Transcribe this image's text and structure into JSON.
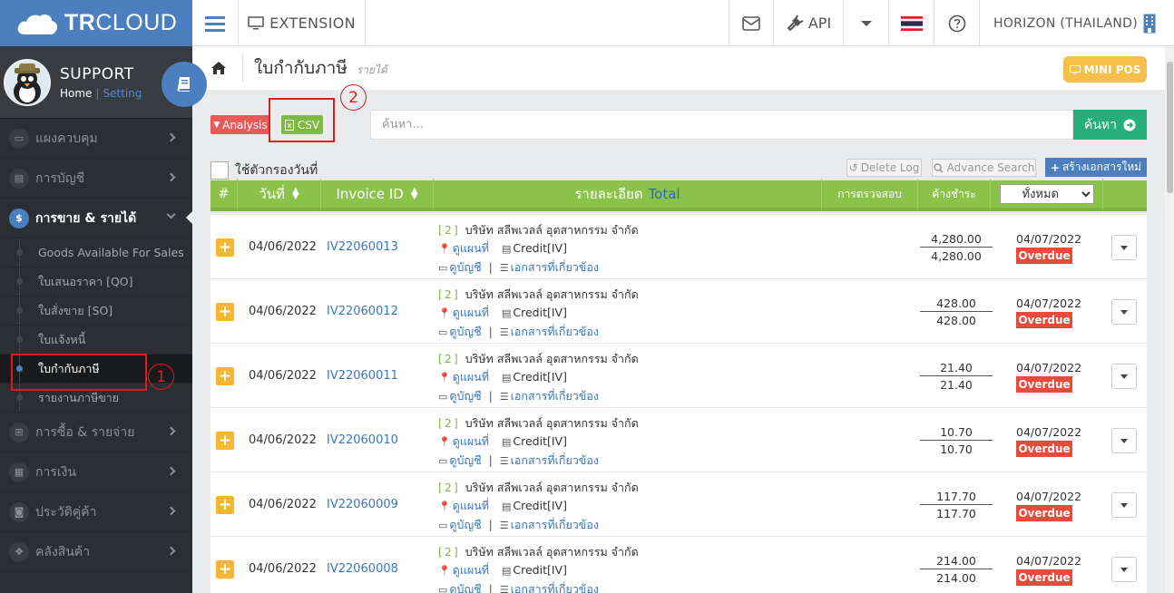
{
  "brand": {
    "text_bold": "TR",
    "text_light": "CLOUD"
  },
  "profile": {
    "name": "SUPPORT",
    "home": "Home",
    "setting": "Setting"
  },
  "sidebar": {
    "items_top": [
      {
        "label": "แผงควบคุม"
      },
      {
        "label": "การบัญชี"
      },
      {
        "label": "การขาย & รายได้"
      }
    ],
    "sub_items": [
      {
        "label": "Goods Available For Sales"
      },
      {
        "label": "ใบเสนอราคา [QO]"
      },
      {
        "label": "ใบสั่งขาย [SO]"
      },
      {
        "label": "ใบแจ้งหนี้"
      },
      {
        "label": "ใบกำกับภาษี"
      },
      {
        "label": "รายงานภาษีขาย"
      }
    ],
    "items_bottom": [
      {
        "label": "การซื้อ & รายจ่าย"
      },
      {
        "label": "การเงิน"
      },
      {
        "label": "ประวัติคู่ค้า"
      },
      {
        "label": "คลังสินค้า"
      }
    ]
  },
  "topbar": {
    "extension": "EXTENSION",
    "api": "API",
    "company": "HORIZON (THAILAND)"
  },
  "page": {
    "title": "ใบกำกับภาษี",
    "subtitle": "รายได้",
    "mini_pos": "MINI POS"
  },
  "toolbar": {
    "analysis": "Analysis",
    "csv": "CSV",
    "search_placeholder": "ค้นหา...",
    "search_btn": "ค้นหา",
    "date_filter": "ใช้ตัวกรองวันที่",
    "delete_log": "Delete Log",
    "advance_search": "Advance Search",
    "create_doc": "สร้างเอกสารใหม่"
  },
  "annotations": {
    "one": "1",
    "two": "2"
  },
  "table": {
    "headers": {
      "num": "#",
      "date": "วันที่",
      "invoice": "Invoice ID",
      "detail": "รายละเอียด",
      "total": "Total",
      "check": "การตรวจสอบ",
      "outstanding": "ค้างชำระ",
      "status_selected": "ทั้งหมด"
    },
    "rows": [
      {
        "date": "04/06/2022",
        "invoice": "IV22060013",
        "count": "[2]",
        "company": "บริษัท สลีพเวลล์ อุตสาหกรรม จำกัด",
        "map": "ดูแผนที่",
        "credit": "Credit[IV]",
        "account": "ดูบัญชี",
        "docs": "เอกสารที่เกี่ยวข้อง",
        "amount1": "4,280.00",
        "amount2": "4,280.00",
        "due": "04/07/2022",
        "status": "Overdue"
      },
      {
        "date": "04/06/2022",
        "invoice": "IV22060012",
        "count": "[2]",
        "company": "บริษัท สลีพเวลล์ อุตสาหกรรม จำกัด",
        "map": "ดูแผนที่",
        "credit": "Credit[IV]",
        "account": "ดูบัญชี",
        "docs": "เอกสารที่เกี่ยวข้อง",
        "amount1": "428.00",
        "amount2": "428.00",
        "due": "04/07/2022",
        "status": "Overdue"
      },
      {
        "date": "04/06/2022",
        "invoice": "IV22060011",
        "count": "[2]",
        "company": "บริษัท สลีพเวลล์ อุตสาหกรรม จำกัด",
        "map": "ดูแผนที่",
        "credit": "Credit[IV]",
        "account": "ดูบัญชี",
        "docs": "เอกสารที่เกี่ยวข้อง",
        "amount1": "21.40",
        "amount2": "21.40",
        "due": "04/07/2022",
        "status": "Overdue"
      },
      {
        "date": "04/06/2022",
        "invoice": "IV22060010",
        "count": "[2]",
        "company": "บริษัท สลีพเวลล์ อุตสาหกรรม จำกัด",
        "map": "ดูแผนที่",
        "credit": "Credit[IV]",
        "account": "ดูบัญชี",
        "docs": "เอกสารที่เกี่ยวข้อง",
        "amount1": "10.70",
        "amount2": "10.70",
        "due": "04/07/2022",
        "status": "Overdue"
      },
      {
        "date": "04/06/2022",
        "invoice": "IV22060009",
        "count": "[2]",
        "company": "บริษัท สลีพเวลล์ อุตสาหกรรม จำกัด",
        "map": "ดูแผนที่",
        "credit": "Credit[IV]",
        "account": "ดูบัญชี",
        "docs": "เอกสารที่เกี่ยวข้อง",
        "amount1": "117.70",
        "amount2": "117.70",
        "due": "04/07/2022",
        "status": "Overdue"
      },
      {
        "date": "04/06/2022",
        "invoice": "IV22060008",
        "count": "[2]",
        "company": "บริษัท สลีพเวลล์ อุตสาหกรรม จำกัด",
        "map": "ดูแผนที่",
        "credit": "Credit[IV]",
        "account": "ดูบัญชี",
        "docs": "เอกสารที่เกี่ยวข้อง",
        "amount1": "214.00",
        "amount2": "214.00",
        "due": "04/07/2022",
        "status": "Overdue"
      }
    ]
  },
  "colors": {
    "brand": "#4c7fc0",
    "green": "#8bc34a",
    "overdue": "#e84b3c",
    "highlight": "#e01b1b"
  }
}
